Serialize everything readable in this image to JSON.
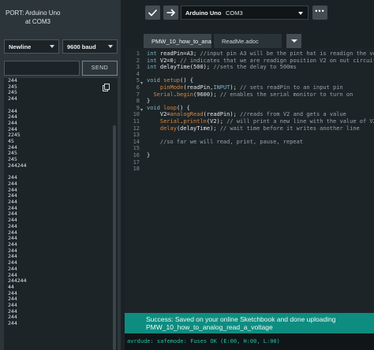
{
  "serial_panel": {
    "port_label": "PORT:",
    "port_board": "Arduino Uno",
    "port_name": "at COM3",
    "line_ending": "Newline",
    "baud_rate": "9600 baud",
    "send_label": "SEND",
    "send_input_value": "",
    "output_lines": [
      "244",
      "245",
      "245",
      "244",
      "",
      "244",
      "244",
      "244",
      "244",
      "2245",
      "45",
      "244",
      "245",
      "245",
      "244244",
      "",
      "244",
      "244",
      "244",
      "244",
      "244",
      "244",
      "244",
      "244",
      "244",
      "244",
      "244",
      "244",
      "244",
      "244",
      "244",
      "244",
      "244",
      "244244",
      "44",
      "244",
      "244",
      "244",
      "244",
      "244",
      "244"
    ]
  },
  "toolbar": {
    "verify_icon": "checkmark-icon",
    "upload_icon": "arrow-right-icon",
    "board_name": "Arduino Uno",
    "board_port": "COM3",
    "more_label": "•••"
  },
  "tabs": [
    {
      "label": "PMW_10_how_to_analo"
    },
    {
      "label": "ReadMe.adoc"
    }
  ],
  "editor": {
    "line_numbers": [
      "1",
      "2",
      "3",
      "4",
      "5",
      "6",
      "7",
      "8",
      "9",
      "10",
      "11",
      "12",
      "13",
      "14",
      "15",
      "16",
      "17",
      "18"
    ],
    "code_lines": [
      "int readPin=A3; //input pin A3 will be the pint hat is readign the voltage",
      "int V2=0; // indicates that we are readign position V2 on out circuit",
      "int delayTime(500); //sets the delay to 500ms",
      "",
      "void setup() {",
      "    pinMode(readPin,INPUT); // sets readPin to an input pin",
      "  Serial.begin(9600); // enables the serial monitor to turn on",
      "}",
      "void loop() {",
      "    V2=analogRead(readPin); //reads from V2 and gets a value",
      "    Serial.println(V2); // will print a new line with the value of V2",
      "    delay(delayTime); // wait time before it writes another line",
      "",
      "    //so far we will read, print, pause, repeat",
      "",
      "}",
      "",
      ""
    ]
  },
  "status": {
    "message": "Success: Saved on your online Sketchbook and done uploading PMW_10_how_to_analog_read_a_voltage",
    "console": "avrdude: safemode: Fuses OK (E:00, H:00, L:00)"
  },
  "colors": {
    "banner": "#0d8d80",
    "console_text": "#26c0a8",
    "keyword": "#7fb1c6",
    "function": "#d9883a"
  }
}
